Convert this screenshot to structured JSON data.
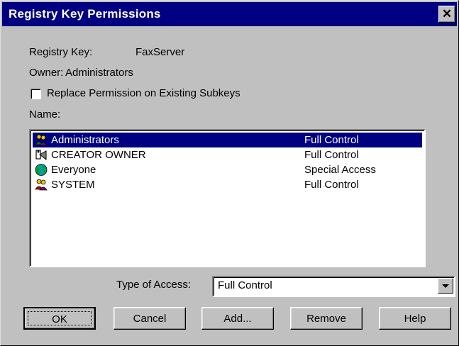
{
  "window": {
    "title": "Registry Key Permissions",
    "close_glyph": "✕"
  },
  "info": {
    "registry_key_label": "Registry Key:",
    "registry_key_value": "FaxServer",
    "owner_label": "Owner:",
    "owner_value": "Administrators"
  },
  "checkbox": {
    "label": "Replace Permission on Existing Subkeys",
    "checked": false
  },
  "list": {
    "header": "Name:",
    "rows": [
      {
        "name": "Administrators",
        "access": "Full Control",
        "selected": true,
        "icon": "group-icon"
      },
      {
        "name": "CREATOR OWNER",
        "access": "Full Control",
        "selected": false,
        "icon": "special-user-icon"
      },
      {
        "name": "Everyone",
        "access": "Special Access",
        "selected": false,
        "icon": "globe-icon"
      },
      {
        "name": "SYSTEM",
        "access": "Full Control",
        "selected": false,
        "icon": "group-icon"
      }
    ]
  },
  "access": {
    "label": "Type of Access:",
    "value": "Full Control"
  },
  "buttons": {
    "ok": "OK",
    "cancel": "Cancel",
    "add": "Add...",
    "remove": "Remove",
    "help": "Help"
  },
  "colors": {
    "titlebar": "#000080",
    "selection": "#000080",
    "face": "#c0c0c0"
  }
}
